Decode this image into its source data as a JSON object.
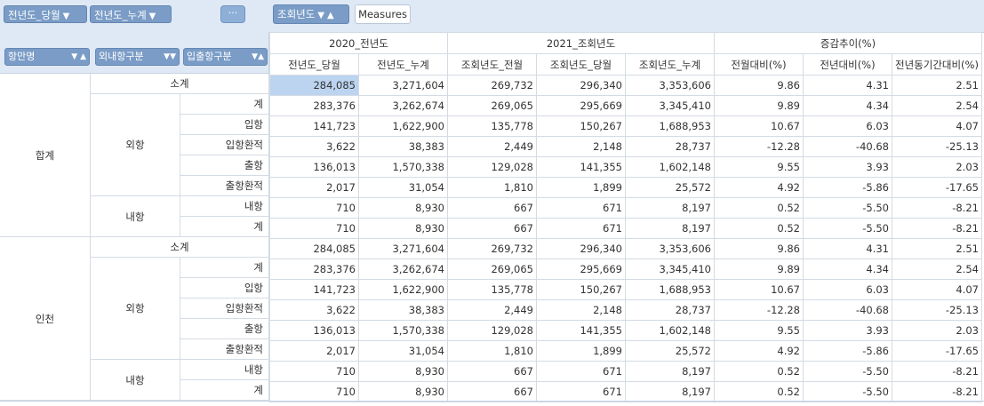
{
  "filters": {
    "chip1": "전년도_당월",
    "chip2": "전년도_누계",
    "more": "···",
    "col_chip": "조회년도",
    "measures": "Measures"
  },
  "row_headers": {
    "h1": "항만명",
    "h2": "외내항구분",
    "h3": "입출항구분"
  },
  "col_groups": [
    "2020_전년도",
    "2021_조회년도",
    "증감추이(%)"
  ],
  "col_headers": [
    "전년도_당월",
    "전년도_누계",
    "조회년도_전월",
    "조회년도_당월",
    "조회년도_누계",
    "전월대비(%)",
    "전년대비(%)",
    "전년동기간대비(%)"
  ],
  "row_labels": {
    "total": "합계",
    "incheon": "인천",
    "subtotal": "소계",
    "foreign": "외항",
    "domestic": "내항",
    "sum": "계",
    "inbound": "입항",
    "inbound_transship": "입항환적",
    "outbound": "출항",
    "outbound_transship": "출항환적",
    "domestic_item": "내항"
  },
  "rows": [
    [
      "284,085",
      "3,271,604",
      "269,732",
      "296,340",
      "3,353,606",
      "9.86",
      "4.31",
      "2.51"
    ],
    [
      "283,376",
      "3,262,674",
      "269,065",
      "295,669",
      "3,345,410",
      "9.89",
      "4.34",
      "2.54"
    ],
    [
      "141,723",
      "1,622,900",
      "135,778",
      "150,267",
      "1,688,953",
      "10.67",
      "6.03",
      "4.07"
    ],
    [
      "3,622",
      "38,383",
      "2,449",
      "2,148",
      "28,737",
      "-12.28",
      "-40.68",
      "-25.13"
    ],
    [
      "136,013",
      "1,570,338",
      "129,028",
      "141,355",
      "1,602,148",
      "9.55",
      "3.93",
      "2.03"
    ],
    [
      "2,017",
      "31,054",
      "1,810",
      "1,899",
      "25,572",
      "4.92",
      "-5.86",
      "-17.65"
    ],
    [
      "710",
      "8,930",
      "667",
      "671",
      "8,197",
      "0.52",
      "-5.50",
      "-8.21"
    ],
    [
      "710",
      "8,930",
      "667",
      "671",
      "8,197",
      "0.52",
      "-5.50",
      "-8.21"
    ],
    [
      "284,085",
      "3,271,604",
      "269,732",
      "296,340",
      "3,353,606",
      "9.86",
      "4.31",
      "2.51"
    ],
    [
      "283,376",
      "3,262,674",
      "269,065",
      "295,669",
      "3,345,410",
      "9.89",
      "4.34",
      "2.54"
    ],
    [
      "141,723",
      "1,622,900",
      "135,778",
      "150,267",
      "1,688,953",
      "10.67",
      "6.03",
      "4.07"
    ],
    [
      "3,622",
      "38,383",
      "2,449",
      "2,148",
      "28,737",
      "-12.28",
      "-40.68",
      "-25.13"
    ],
    [
      "136,013",
      "1,570,338",
      "129,028",
      "141,355",
      "1,602,148",
      "9.55",
      "3.93",
      "2.03"
    ],
    [
      "2,017",
      "31,054",
      "1,810",
      "1,899",
      "25,572",
      "4.92",
      "-5.86",
      "-17.65"
    ],
    [
      "710",
      "8,930",
      "667",
      "671",
      "8,197",
      "0.52",
      "-5.50",
      "-8.21"
    ],
    [
      "710",
      "8,930",
      "667",
      "671",
      "8,197",
      "0.52",
      "-5.50",
      "-8.21"
    ]
  ],
  "colors": {
    "chip_bg": "#7a9cc6",
    "header_bg": "#dfe9f5",
    "selected_cell": "#bcd4f0"
  }
}
